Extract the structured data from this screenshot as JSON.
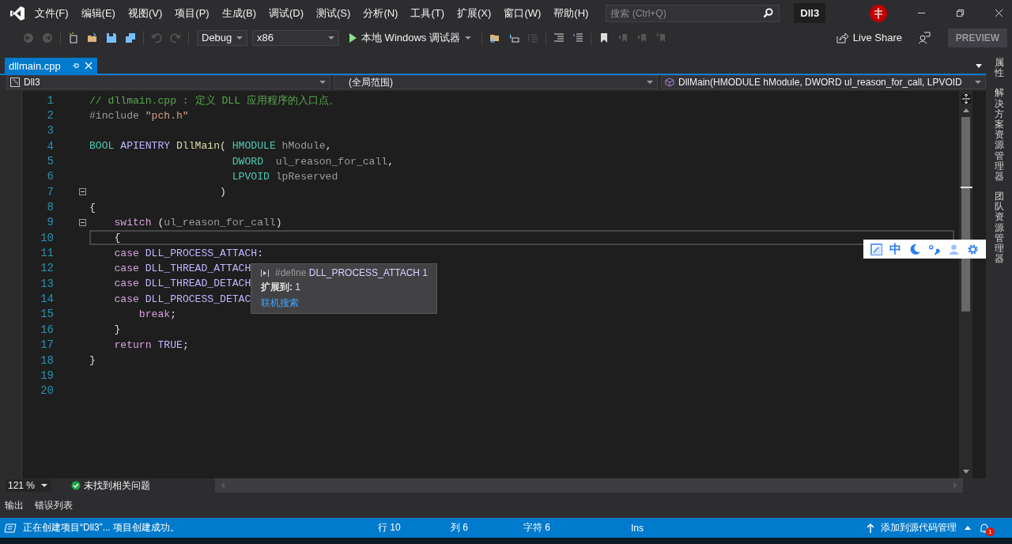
{
  "menu": [
    "文件(F)",
    "编辑(E)",
    "视图(V)",
    "项目(P)",
    "生成(B)",
    "调试(D)",
    "测试(S)",
    "分析(N)",
    "工具(T)",
    "扩展(X)",
    "窗口(W)",
    "帮助(H)"
  ],
  "search": {
    "placeholder": "搜索 (Ctrl+Q)"
  },
  "solution_name": "Dll3",
  "toolbar": {
    "configuration": "Debug",
    "platform": "x86",
    "run_label": "本地 Windows 调试器",
    "live_share": "Live Share",
    "preview": "PREVIEW"
  },
  "tabs": [
    {
      "label": "dllmain.cpp",
      "selected": true
    }
  ],
  "navigation": {
    "project": "Dll3",
    "scope": "(全局范围)",
    "member": "DllMain(HMODULE hModule, DWORD ul_reason_for_call, LPVOID"
  },
  "code_lines": [
    {
      "number": "1",
      "current": false,
      "fold_marker": false,
      "tokens": [
        {
          "kind": "comment",
          "text": "// dllmain.cpp : 定义 DLL 应用程序的入口点。"
        }
      ]
    },
    {
      "number": "2",
      "current": false,
      "fold_marker": false,
      "tokens": [
        {
          "kind": "preproc",
          "text": "#include "
        },
        {
          "kind": "string",
          "text": "\"pch.h\""
        }
      ]
    },
    {
      "number": "3",
      "current": false,
      "fold_marker": false
    },
    {
      "number": "4",
      "current": false,
      "fold_marker": false,
      "tokens": [
        {
          "kind": "type",
          "text": "BOOL"
        },
        {
          "kind": "macro",
          "text": " APIENTRY"
        },
        {
          "kind": "function",
          "text": " DllMain"
        },
        {
          "kind": "plain",
          "text": "( "
        },
        {
          "kind": "type",
          "text": "HMODULE"
        },
        {
          "kind": "param",
          "text": " hModule"
        },
        {
          "kind": "plain",
          "text": ","
        }
      ]
    },
    {
      "number": "5",
      "current": false,
      "fold_marker": false,
      "tokens": [
        {
          "kind": "type",
          "text": "                       DWORD"
        },
        {
          "kind": "param",
          "text": "  ul_reason_for_call"
        },
        {
          "kind": "plain",
          "text": ","
        }
      ]
    },
    {
      "number": "6",
      "current": false,
      "fold_marker": false,
      "tokens": [
        {
          "kind": "type",
          "text": "                       LPVOID"
        },
        {
          "kind": "param",
          "text": " lpReserved"
        }
      ]
    },
    {
      "number": "7",
      "current": false,
      "fold_marker": true,
      "tokens": [
        {
          "kind": "plain",
          "text": "                     )"
        }
      ]
    },
    {
      "number": "8",
      "current": false,
      "fold_marker": false,
      "tokens": [
        {
          "kind": "plain",
          "text": "{"
        }
      ]
    },
    {
      "number": "9",
      "current": false,
      "fold_marker": true,
      "tokens": [
        {
          "kind": "control",
          "text": "    switch"
        },
        {
          "kind": "plain",
          "text": " ("
        },
        {
          "kind": "param",
          "text": "ul_reason_for_call"
        },
        {
          "kind": "plain",
          "text": ")"
        }
      ]
    },
    {
      "number": "10",
      "current": true,
      "fold_marker": false,
      "tokens": [
        {
          "kind": "plain",
          "text": "    {"
        }
      ]
    },
    {
      "number": "11",
      "current": false,
      "fold_marker": false,
      "tokens": [
        {
          "kind": "control",
          "text": "    case"
        },
        {
          "kind": "macro",
          "text": " DLL_PROCESS_ATTACH"
        },
        {
          "kind": "plain",
          "text": ":"
        }
      ]
    },
    {
      "number": "12",
      "current": false,
      "fold_marker": false,
      "tokens": [
        {
          "kind": "control",
          "text": "    case"
        },
        {
          "kind": "macro",
          "text": " DLL_THREAD_ATTACH"
        }
      ]
    },
    {
      "number": "13",
      "current": false,
      "fold_marker": false,
      "tokens": [
        {
          "kind": "control",
          "text": "    case"
        },
        {
          "kind": "macro",
          "text": " DLL_THREAD_DETACH"
        }
      ]
    },
    {
      "number": "14",
      "current": false,
      "fold_marker": false,
      "tokens": [
        {
          "kind": "control",
          "text": "    case"
        },
        {
          "kind": "macro",
          "text": " DLL_PROCESS_DETAC"
        }
      ]
    },
    {
      "number": "15",
      "current": false,
      "fold_marker": false,
      "tokens": [
        {
          "kind": "control",
          "text": "        break"
        },
        {
          "kind": "plain",
          "text": ";"
        }
      ]
    },
    {
      "number": "16",
      "current": false,
      "fold_marker": false,
      "tokens": [
        {
          "kind": "plain",
          "text": "    }"
        }
      ]
    },
    {
      "number": "17",
      "current": false,
      "fold_marker": false,
      "tokens": [
        {
          "kind": "control",
          "text": "    return"
        },
        {
          "kind": "macro",
          "text": " TRUE"
        },
        {
          "kind": "plain",
          "text": ";"
        }
      ]
    },
    {
      "number": "18",
      "current": false,
      "fold_marker": false,
      "tokens": [
        {
          "kind": "plain",
          "text": "}"
        }
      ]
    },
    {
      "number": "19",
      "current": false,
      "fold_marker": false
    },
    {
      "number": "20",
      "current": false,
      "fold_marker": false
    }
  ],
  "quick_info": {
    "directive": "#define",
    "definition": "DLL_PROCESS_ATTACH 1",
    "expansion": "**扩展到:** 1",
    "link": "联机搜索"
  },
  "ime_toolbar": {
    "mode": "中"
  },
  "side_tabs": [
    "属性",
    "解决方案资源管理器",
    "团队资源管理器"
  ],
  "editor_status": {
    "zoom": "121 %",
    "issues": "未找到相关问题"
  },
  "panel_tabs": [
    "输出",
    "错误列表"
  ],
  "status_bar": {
    "message": "正在创建项目“Dll3”... 项目创建成功。",
    "line": "行 10",
    "column": "列 6",
    "char": "字符 6",
    "mode": "Ins",
    "source_control": "添加到源代码管理",
    "notifications": "1"
  }
}
